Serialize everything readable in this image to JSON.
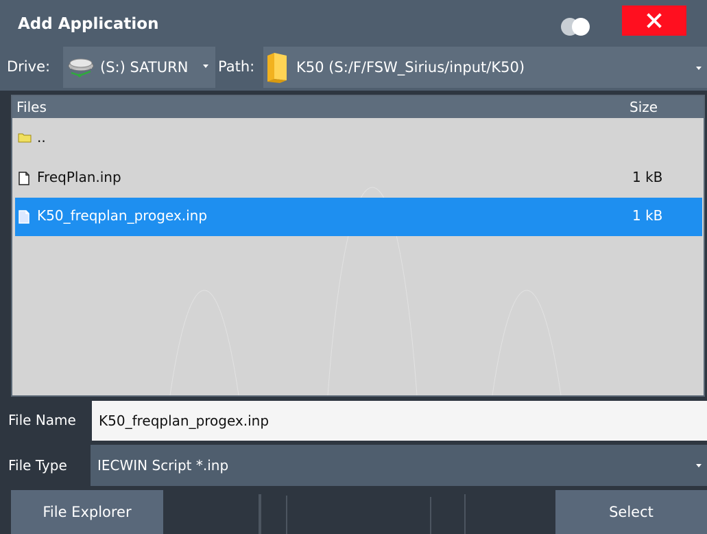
{
  "dialog": {
    "title": "Add Application",
    "close_icon": "close-icon",
    "toggle_icon": "toggle-icon"
  },
  "drive_row": {
    "drive_label": "Drive:",
    "drive_value": "(S:) SATURN",
    "drive_icon": "network-drive-icon",
    "path_label": "Path:",
    "path_value": "K50 (S:/F/FSW_Sirius/input/K50)",
    "path_icon": "folder-icon"
  },
  "file_list": {
    "columns": {
      "files": "Files",
      "size": "Size"
    },
    "rows": [
      {
        "name": "..",
        "size": "",
        "icon": "folder-icon"
      },
      {
        "name": "FreqPlan.inp",
        "size": "1 kB",
        "icon": "file-icon"
      },
      {
        "name": "K50_freqplan_progex.inp",
        "size": "1 kB",
        "icon": "file-icon",
        "selected": true
      }
    ]
  },
  "file_name": {
    "label": "File Name",
    "value": "K50_freqplan_progex.inp"
  },
  "file_type": {
    "label": "File Type",
    "value": "IECWIN Script *.inp"
  },
  "buttons": {
    "file_explorer": "File Explorer",
    "select": "Select"
  },
  "colors": {
    "close": "#ff0f1f",
    "selection": "#1e8ff0",
    "titlebar": "#4f5e6e"
  }
}
